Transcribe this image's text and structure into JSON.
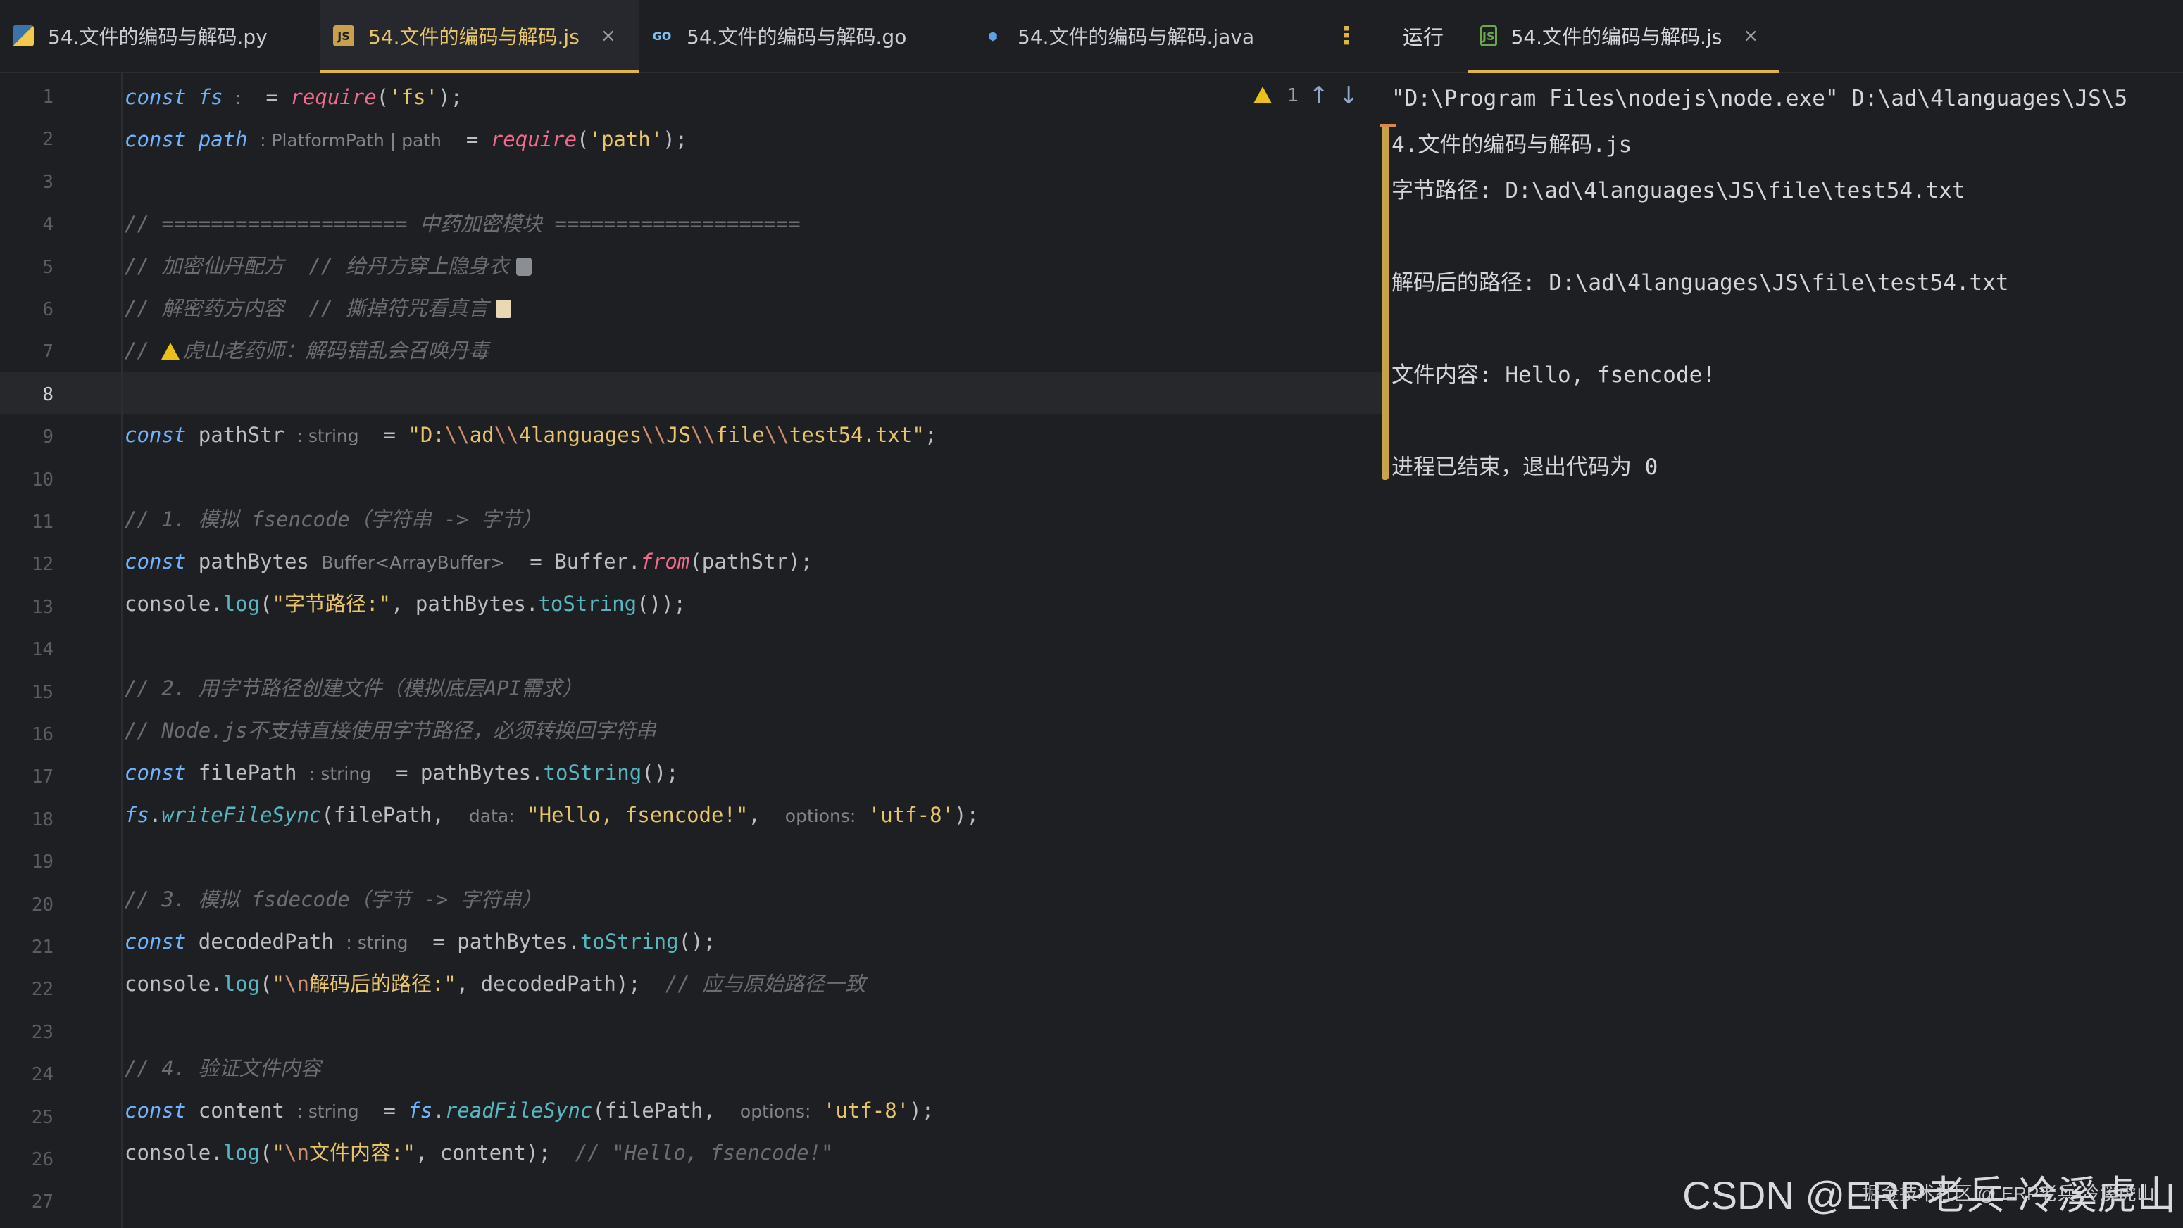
{
  "editor_tabs": [
    {
      "label": "54.文件的编码与解码.py",
      "icon": "python-icon",
      "active": false
    },
    {
      "label": "54.文件的编码与解码.js",
      "icon": "js-file-icon",
      "active": true,
      "closable": true
    },
    {
      "label": "54.文件的编码与解码.go",
      "icon": "go-file-icon",
      "active": false
    },
    {
      "label": "54.文件的编码与解码.java",
      "icon": "java-file-icon",
      "active": false
    }
  ],
  "run_panel": {
    "label": "运行",
    "tab_label": "54.文件的编码与解码.js",
    "output": [
      "\"D:\\Program Files\\nodejs\\node.exe\" D:\\ad\\4languages\\JS\\5",
      "4.文件的编码与解码.js",
      "字节路径: D:\\ad\\4languages\\JS\\file\\test54.txt",
      "",
      "解码后的路径: D:\\ad\\4languages\\JS\\file\\test54.txt",
      "",
      "文件内容: Hello, fsencode!",
      "",
      "进程已结束，退出代码为 0"
    ]
  },
  "inspection": {
    "warning_count": "1"
  },
  "current_line": 8,
  "line_numbers": [
    "1",
    "2",
    "3",
    "4",
    "5",
    "6",
    "7",
    "8",
    "9",
    "10",
    "11",
    "12",
    "13",
    "14",
    "15",
    "16",
    "17",
    "18",
    "19",
    "20",
    "21",
    "22",
    "23",
    "24",
    "25",
    "26",
    "27"
  ],
  "code": {
    "kw_const": "const",
    "fs": "fs",
    "path": "path",
    "require": "require",
    "str_fs": "'fs'",
    "str_path": "'path'",
    "hint_platformpath": "PlatformPath | path",
    "hint_string": "string",
    "hint_buffer": "Buffer<ArrayBuffer>",
    "hint_data": "data:",
    "hint_options": "options:",
    "c4": "// ==================== 中药加密模块 ====================",
    "c5a": "// 加密仙丹配方",
    "c5b": "// 给丹方穿上隐身衣",
    "c6a": "// 解密药方内容",
    "c6b": "// 撕掉符咒看真言",
    "c7a": "//",
    "c7b": "虎山老药师：解码错乱会召唤丹毒",
    "pathStr": "pathStr",
    "path_str_1": "\"D:",
    "path_str_2": "ad",
    "path_str_3": "4languages",
    "path_str_4": "JS",
    "path_str_5": "file",
    "path_str_6": "test54.txt\"",
    "esc": "\\\\",
    "c11": "// 1. 模拟 fsencode（字符串 -> 字节）",
    "pathBytes": "pathBytes",
    "buffer": "Buffer",
    "from": "from",
    "console": "console",
    "log": "log",
    "str_bytes_label": "\"字节路径:\"",
    "toString": "toString",
    "c15": "// 2. 用字节路径创建文件（模拟底层API需求）",
    "c16": "// Node.js不支持直接使用字节路径，必须转换回字符串",
    "filePath": "filePath",
    "writeFileSync": "writeFileSync",
    "str_hello": "\"Hello, fsencode!\"",
    "str_utf8": "'utf-8'",
    "c20": "// 3. 模拟 fsdecode（字节 -> 字符串）",
    "decodedPath": "decodedPath",
    "str_decoded_label_1": "\"",
    "str_n": "\\n",
    "str_decoded_label_2": "解码后的路径:\"",
    "c22": "// 应与原始路径一致",
    "c24": "// 4. 验证文件内容",
    "content": "content",
    "readFileSync": "readFileSync",
    "str_content_label_2": "文件内容:\"",
    "c26": "// \"Hello, fsencode!\""
  },
  "watermark": "CSDN @ERP老兵-冷溪虎山",
  "watermark_small": "掘金技术社区 @ ERP老兵-冷溪虎山",
  "colors": {
    "accent": "#e0b54a",
    "keyword": "#6fb3ff",
    "string": "#e8c46a",
    "comment": "#6a6d72"
  }
}
